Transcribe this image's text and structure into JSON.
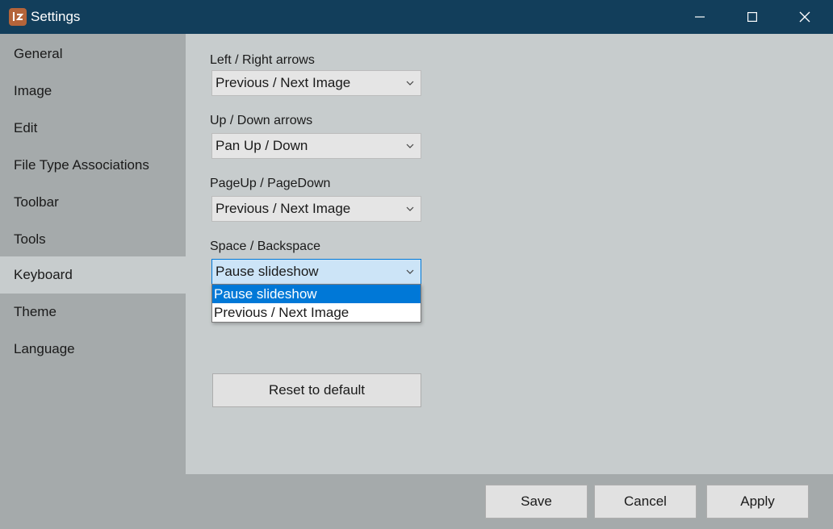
{
  "window": {
    "title": "Settings",
    "icons": {
      "app": "image-viewer-app-icon",
      "minimize": "minimize-icon",
      "maximize": "maximize-icon",
      "close": "close-icon"
    }
  },
  "sidebar": {
    "items": [
      {
        "label": "General"
      },
      {
        "label": "Image"
      },
      {
        "label": "Edit"
      },
      {
        "label": "File Type Associations"
      },
      {
        "label": "Toolbar"
      },
      {
        "label": "Tools"
      },
      {
        "label": "Keyboard"
      },
      {
        "label": "Theme"
      },
      {
        "label": "Language"
      }
    ],
    "active": "Keyboard"
  },
  "keyboard": {
    "settings": [
      {
        "label": "Left / Right arrows",
        "value": "Previous / Next Image"
      },
      {
        "label": "Up / Down arrows",
        "value": "Pan Up / Down"
      },
      {
        "label": "PageUp / PageDown",
        "value": "Previous / Next Image"
      },
      {
        "label": "Space / Backspace",
        "value": "Pause slideshow"
      }
    ],
    "open_dropdown": {
      "options": [
        "Pause slideshow",
        "Previous / Next Image"
      ],
      "highlighted": "Pause slideshow"
    },
    "reset_label": "Reset to default"
  },
  "footer": {
    "save": "Save",
    "cancel": "Cancel",
    "apply": "Apply"
  },
  "colors": {
    "titlebar": "#123e5b",
    "sidebar": "#a5aaab",
    "content": "#c7cccd",
    "accent": "#0078d7"
  }
}
